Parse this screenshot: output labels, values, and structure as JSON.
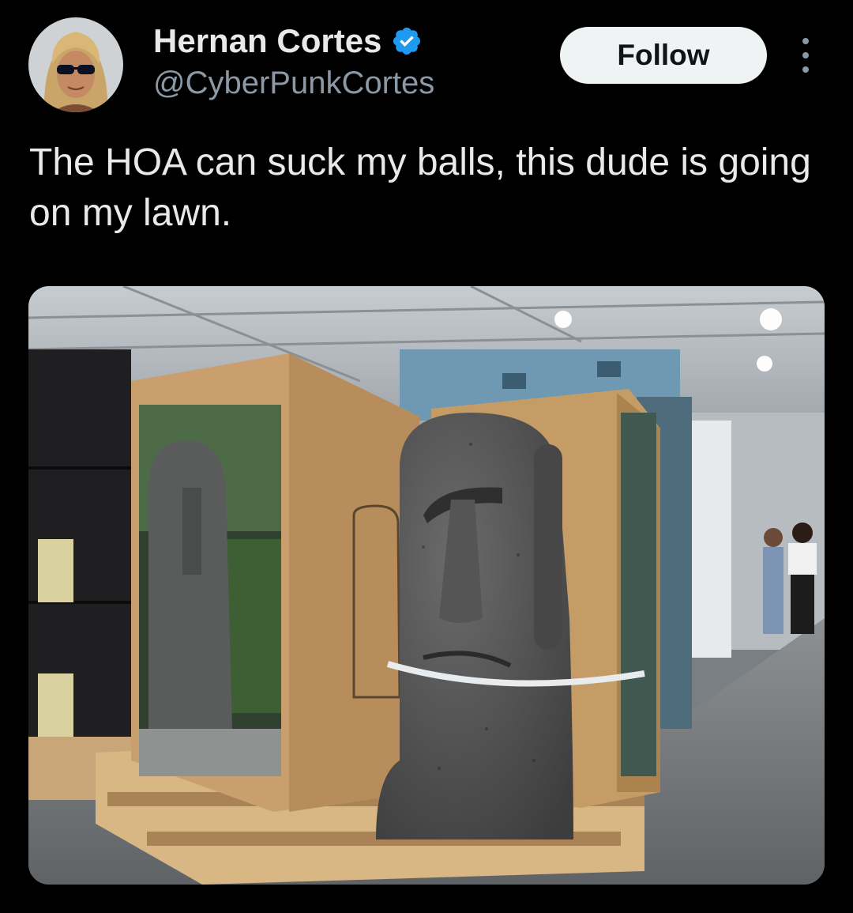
{
  "tweet": {
    "author": {
      "display_name": "Hernan Cortes",
      "handle": "@CyberPunkCortes",
      "verified": true,
      "avatar_icon": "avatar-photo"
    },
    "follow_label": "Follow",
    "more_icon": "more-vertical-icon",
    "text": "The HOA can suck my balls, this dude is going on my lawn.",
    "media": {
      "type": "photo",
      "icon": "photo-moai-statues"
    }
  },
  "colors": {
    "background": "#000000",
    "text_primary": "#e7e9ea",
    "text_secondary": "#8b98a5",
    "verified_blue": "#1d9bf0",
    "follow_bg": "#eff3f4",
    "follow_text": "#0f1419"
  }
}
